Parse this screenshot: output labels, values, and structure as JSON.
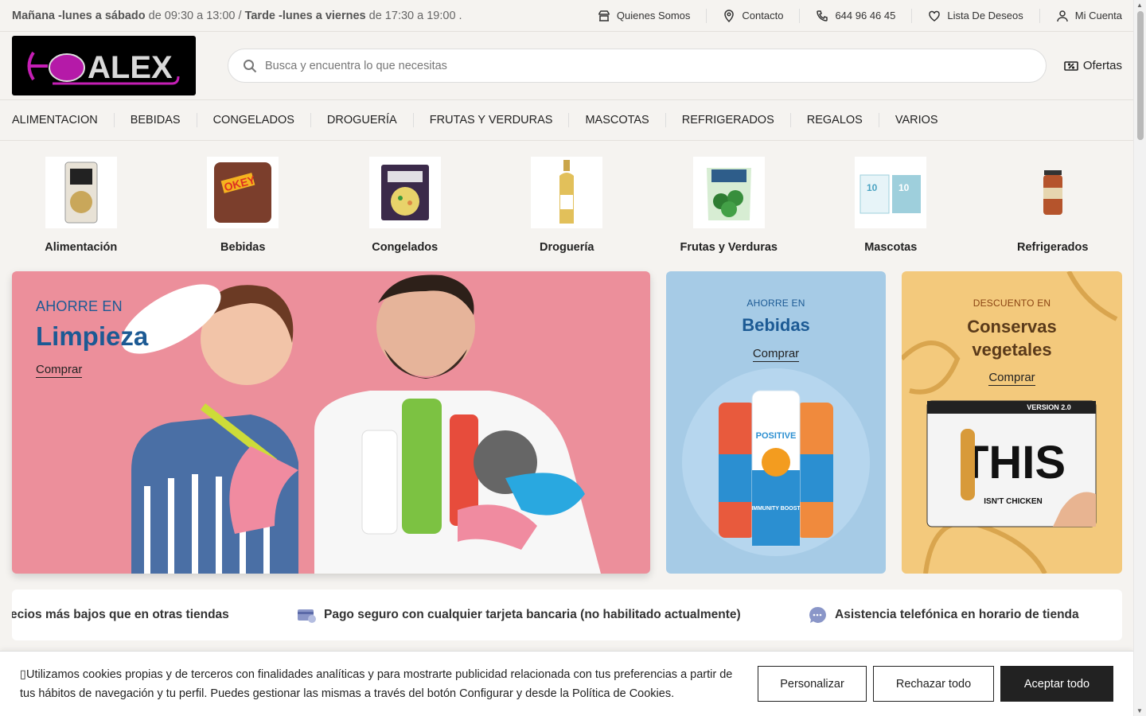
{
  "topbar": {
    "hours_a_bold": "Mañana -lunes a sábado",
    "hours_a_rest": " de 09:30 a 13:00 / ",
    "hours_b_bold": "Tarde -lunes a viernes",
    "hours_b_rest": " de 17:30 a 19:00 .",
    "links": [
      "Quienes Somos",
      "Contacto",
      "644 96 46 45",
      "Lista De Deseos",
      "Mi Cuenta"
    ]
  },
  "header": {
    "logo_text": "ALEX",
    "search_placeholder": "Busca y encuentra lo que necesitas",
    "ofertas_label": "Ofertas"
  },
  "nav": [
    "ALIMENTACION",
    "BEBIDAS",
    "CONGELADOS",
    "DROGUERÍA",
    "FRUTAS Y VERDURAS",
    "MASCOTAS",
    "REFRIGERADOS",
    "REGALOS",
    "VARIOS"
  ],
  "categories": [
    {
      "label": "Alimentación",
      "color": "#c9a75a"
    },
    {
      "label": "Bebidas",
      "color": "#7b3e2c"
    },
    {
      "label": "Congelados",
      "color": "#3b2a4a"
    },
    {
      "label": "Droguería",
      "color": "#e2c05a"
    },
    {
      "label": "Frutas y Verduras",
      "color": "#2e7d32"
    },
    {
      "label": "Mascotas",
      "color": "#9ecfdc"
    },
    {
      "label": "Refrigerados",
      "color": "#b5542c"
    }
  ],
  "banners": {
    "main": {
      "kicker": "AHORRE EN",
      "title": "Limpieza",
      "link": "Comprar"
    },
    "drinks": {
      "kicker": "AHORRE EN",
      "title": "Bebidas",
      "link": "Comprar",
      "can_brand": "POSITIVE",
      "can_text": "IMMUNITY BOOST"
    },
    "conservas": {
      "kicker": "DESCUENTO EN",
      "title_line1": "Conservas",
      "title_line2": "vegetales",
      "link": "Comprar",
      "pack_version": "VERSION 2.0",
      "pack_title": "THIS",
      "pack_sub": "ISN'T CHICKEN"
    }
  },
  "features": [
    "ecios más bajos que en otras tiendas",
    "Pago seguro con cualquier tarjeta bancaria (no habilitado actualmente)",
    "Asistencia telefónica en horario de tienda"
  ],
  "cookie": {
    "text": "Utilizamos cookies propias y de terceros con finalidades analíticas y para mostrarte publicidad relacionada con tus preferencias a partir de tus hábitos de navegación y tu perfil. Puedes gestionar las mismas a través del botón Configurar y desde la Política de Cookies.",
    "personalizar": "Personalizar",
    "rechazar": "Rechazar todo",
    "aceptar": "Aceptar todo"
  },
  "colors": {
    "brand_blue": "#1c5a94",
    "pink": "#ec8f9b",
    "light_blue": "#a6cbe6",
    "yellow": "#f3c97c"
  }
}
